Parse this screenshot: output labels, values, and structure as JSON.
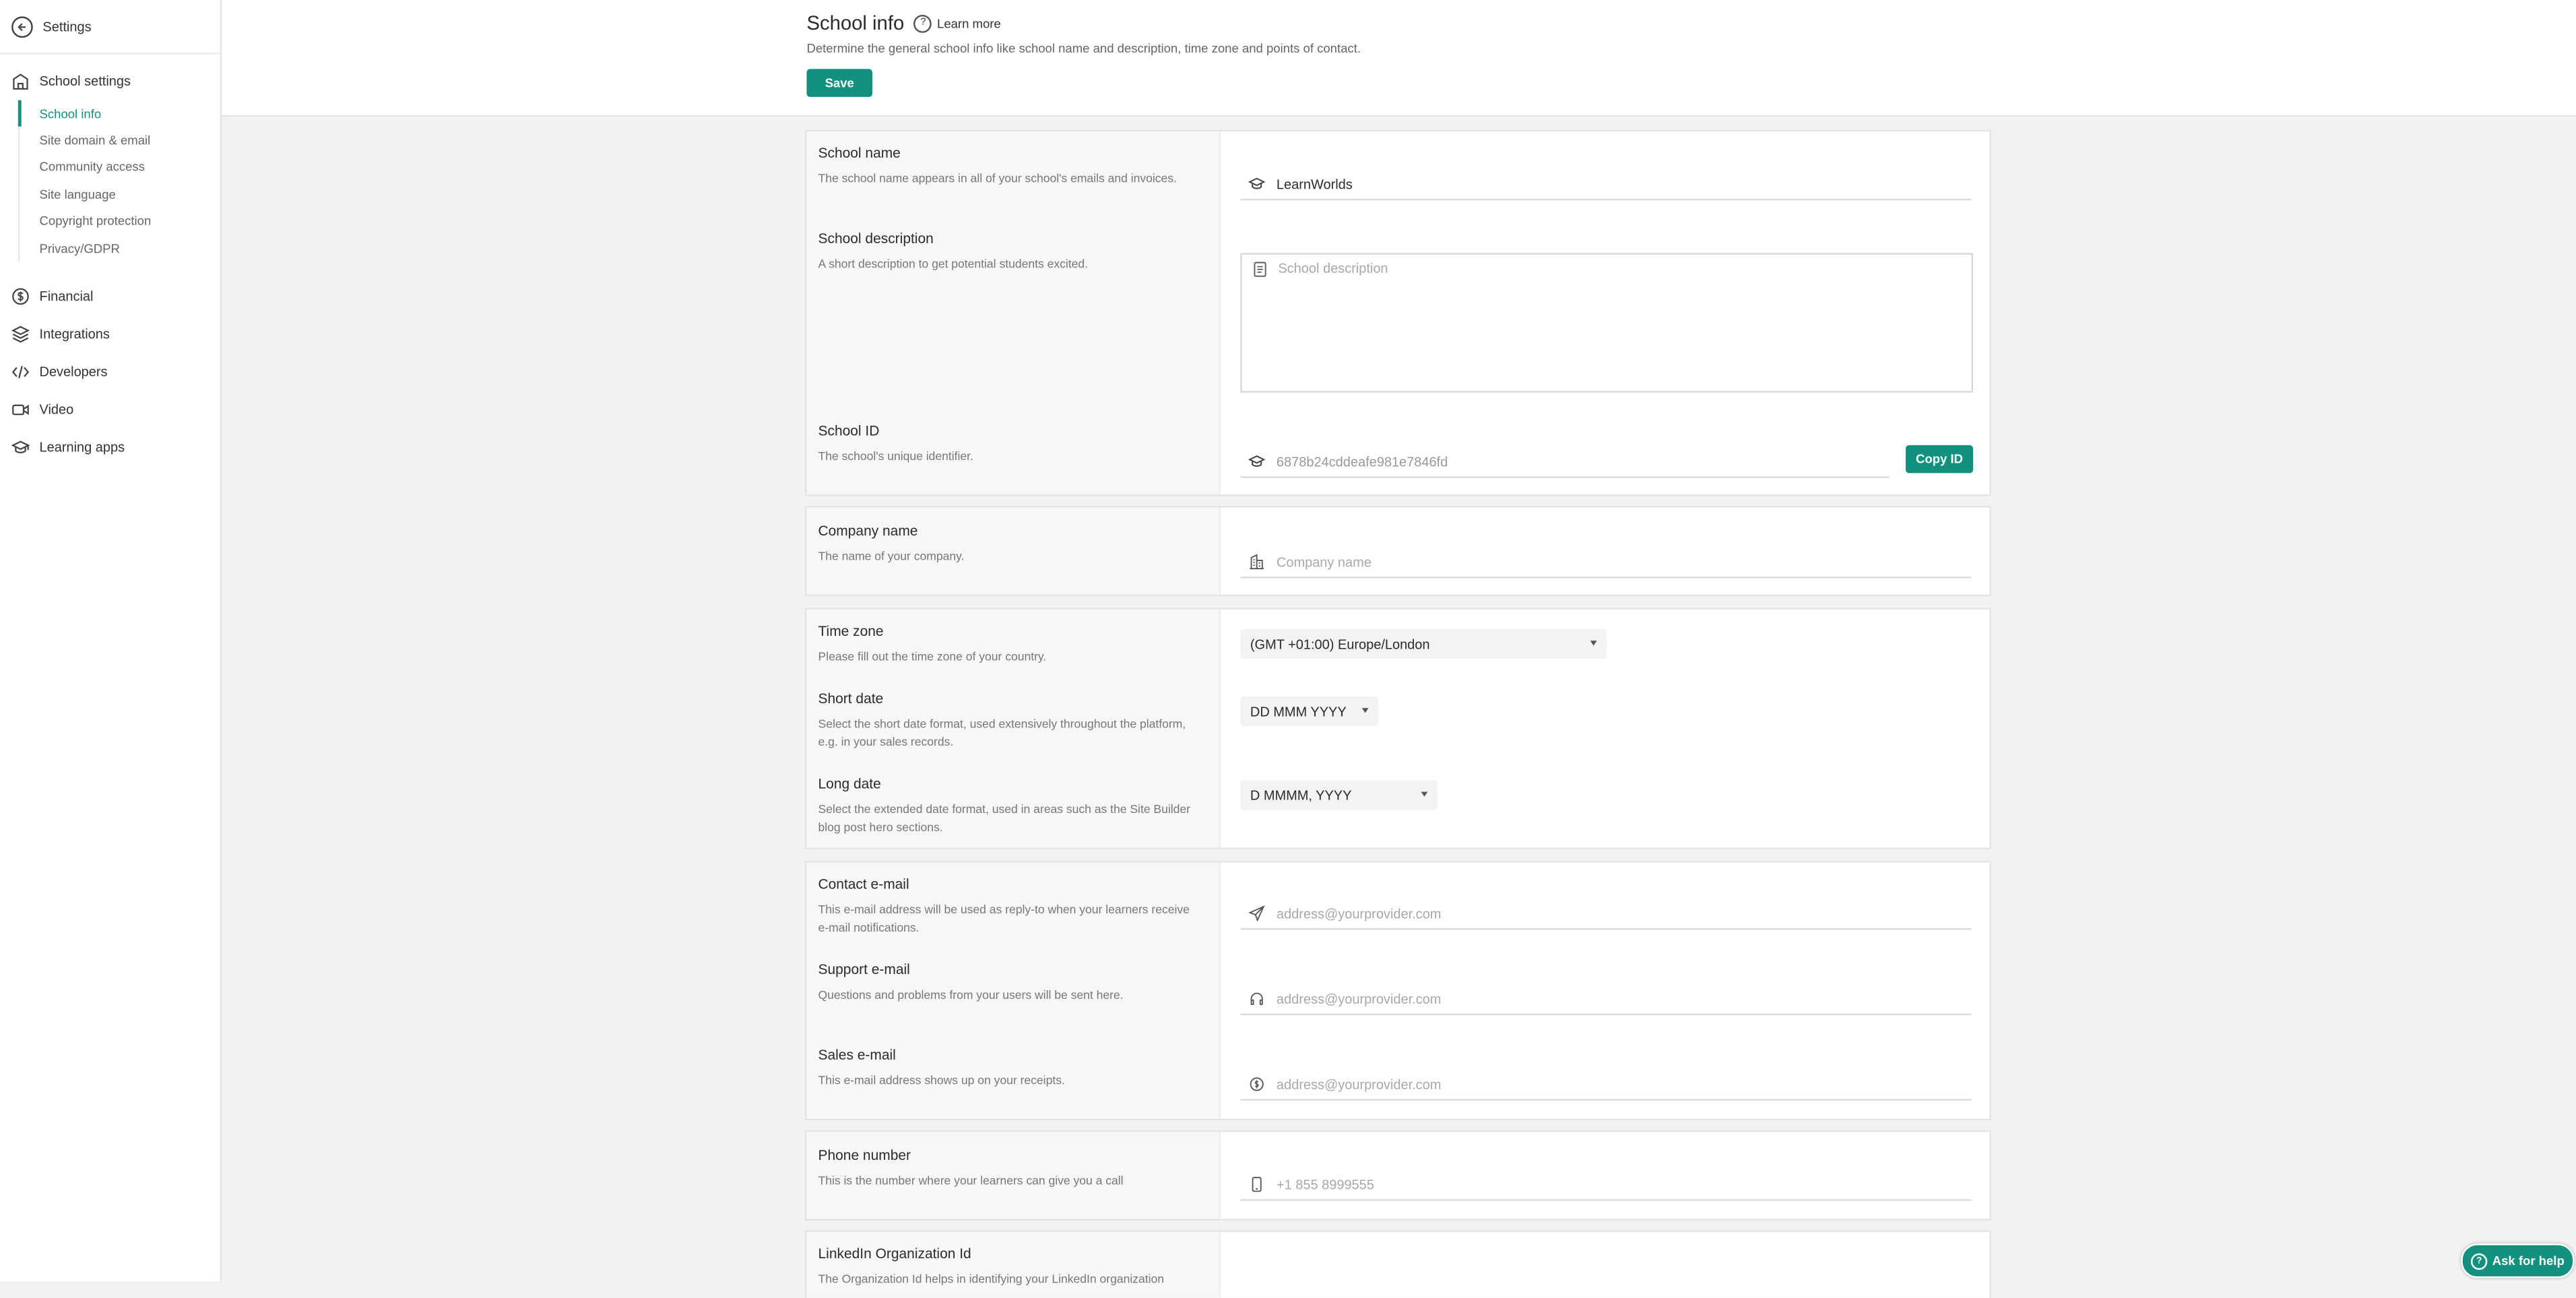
{
  "sidebar": {
    "back_label": "Settings",
    "school_settings": {
      "label": "School settings",
      "items": [
        "School info",
        "Site domain & email",
        "Community access",
        "Site language",
        "Copyright protection",
        "Privacy/GDPR"
      ]
    },
    "groups": [
      "Financial",
      "Integrations",
      "Developers",
      "Video",
      "Learning apps"
    ]
  },
  "header": {
    "title": "School info",
    "learn_more": "Learn more",
    "subtitle": "Determine the general school info like school name and description, time zone and points of contact.",
    "save_label": "Save"
  },
  "school": {
    "name_label": "School name",
    "name_desc": "The school name appears in all of your school's emails and invoices.",
    "name_value": "LearnWorlds",
    "desc_label": "School description",
    "desc_desc": "A short description to get potential students excited.",
    "desc_placeholder": "School description",
    "id_label": "School ID",
    "id_desc": "The school's unique identifier.",
    "id_value": "6878b24cddeafe981e7846fd",
    "copy_label": "Copy ID"
  },
  "company": {
    "label": "Company name",
    "desc": "The name of your company.",
    "placeholder": "Company name"
  },
  "time": {
    "tz_label": "Time zone",
    "tz_desc": "Please fill out the time zone of your country.",
    "tz_value": "(GMT +01:00) Europe/London",
    "short_label": "Short date",
    "short_desc": "Select the short date format, used extensively throughout the platform, e.g. in your sales records.",
    "short_value": "DD MMM YYYY",
    "long_label": "Long date",
    "long_desc": "Select the extended date format, used in areas such as the Site Builder blog post hero sections.",
    "long_value": "D MMMM, YYYY"
  },
  "contact": {
    "contact_label": "Contact e-mail",
    "contact_desc": "This e-mail address will be used as reply-to when your learners receive e-mail notifications.",
    "support_label": "Support e-mail",
    "support_desc": "Questions and problems from your users will be sent here.",
    "sales_label": "Sales e-mail",
    "sales_desc": "This e-mail address shows up on your receipts.",
    "email_placeholder": "address@yourprovider.com"
  },
  "phone": {
    "label": "Phone number",
    "desc": "This is the number where your learners can give you a call",
    "placeholder": "+1 855 8999555"
  },
  "linkedin": {
    "label": "LinkedIn Organization Id",
    "desc": "The Organization Id helps in identifying your LinkedIn organization"
  },
  "help_label": "Ask for help",
  "colors": {
    "accent": "#13917e"
  }
}
